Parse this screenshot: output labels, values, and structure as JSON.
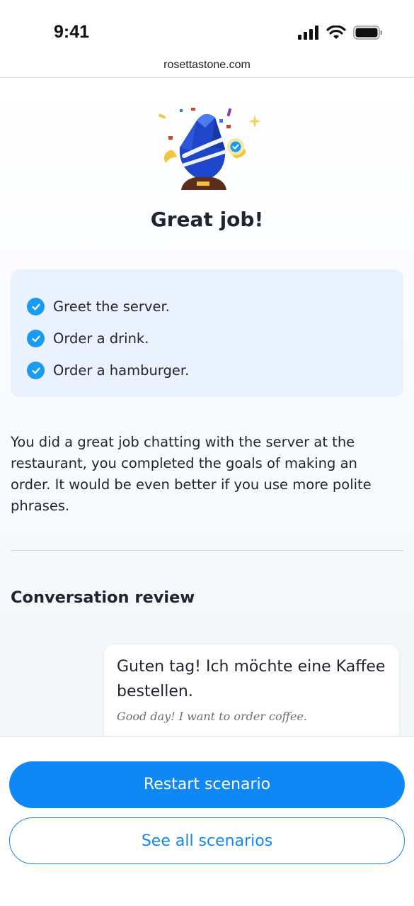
{
  "status_bar": {
    "time": "9:41"
  },
  "browser": {
    "url": "rosettastone.com"
  },
  "header": {
    "title": "Great job!"
  },
  "goals": [
    {
      "label": "Greet the server."
    },
    {
      "label": "Order a drink."
    },
    {
      "label": "Order a hamburger."
    }
  ],
  "feedback": "You did a great job chatting with the server at the restaurant, you completed the goals of making an order. It would be even better if you use more polite phrases.",
  "review": {
    "title": "Conversation review",
    "message": {
      "text": "Guten tag! Ich möchte eine Kaffee bestellen.",
      "translation": "Good day! I want to order coffee."
    }
  },
  "actions": {
    "restart_label": "Restart scenario",
    "see_all_label": "See all scenarios"
  },
  "colors": {
    "accent": "#0f87f5",
    "check": "#1b9bf0",
    "goals_bg": "#eaf3fd"
  },
  "icons": [
    "signal-icon",
    "wifi-icon",
    "battery-icon",
    "trophy-icon",
    "check-icon"
  ]
}
